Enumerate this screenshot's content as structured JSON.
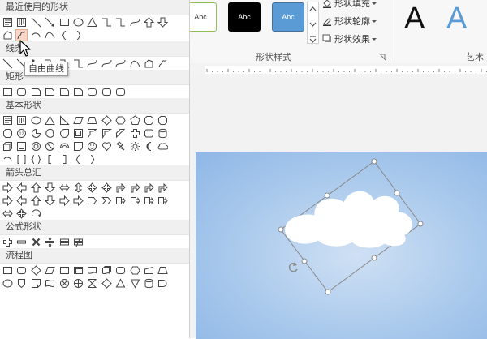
{
  "gallery": {
    "sections": [
      {
        "title": "最近使用的形状",
        "rows": [
          [
            "text-box",
            "vertical-text-box",
            "line",
            "arrow-line",
            "rectangle",
            "oval",
            "triangle",
            "elbow-connector",
            "elbow-arrow",
            "curved-arrow",
            "up-arrow",
            "down-arrow"
          ],
          [
            "freeform-shape",
            "freeform-scribble",
            "arc",
            "curve",
            "left-brace",
            "right-brace"
          ]
        ]
      },
      {
        "title": "线条",
        "rows": [
          [
            "line",
            "arrow-line",
            "double-arrow-line",
            "elbow-connector",
            "elbow-arrow",
            "elbow-double-arrow",
            "curved-connector",
            "curved-arrow",
            "curved-double-arrow",
            "curve",
            "freeform-shape",
            "freeform-scribble"
          ]
        ]
      },
      {
        "title": "矩形",
        "rows": [
          [
            "rectangle",
            "rounded-rectangle",
            "snip-corner-rectangle",
            "snip-same-side-rectangle",
            "snip-diagonal-rectangle",
            "snip-round-rectangle",
            "round-same-side-rectangle",
            "round-diagonal-rectangle",
            "round-corner-rectangle"
          ]
        ]
      },
      {
        "title": "基本形状",
        "rows": [
          [
            "text-box",
            "vertical-text-box",
            "oval",
            "triangle",
            "right-triangle",
            "parallelogram",
            "trapezoid",
            "diamond",
            "hexagon",
            "pentagon",
            "octagon",
            "decagon"
          ],
          [
            "dodecagon",
            "number-12",
            "pie",
            "chord",
            "teardrop",
            "frame",
            "half-frame",
            "l-shape",
            "diagonal-stripe",
            "cross",
            "plaque",
            "can"
          ],
          [
            "cube",
            "bevel",
            "donut",
            "no-symbol",
            "block-arc",
            "folded-corner",
            "smiley-face",
            "heart",
            "lightning-bolt",
            "sun",
            "moon",
            "cloud"
          ],
          [
            "arc",
            "double-bracket",
            "double-brace",
            "left-bracket",
            "right-bracket",
            "left-brace",
            "right-brace"
          ]
        ]
      },
      {
        "title": "箭头总汇",
        "rows": [
          [
            "right-arrow",
            "left-arrow",
            "up-arrow",
            "down-arrow",
            "left-right-arrow",
            "up-down-arrow",
            "quad-arrow",
            "left-right-up-arrow",
            "bent-arrow",
            "u-turn-arrow",
            "left-up-arrow",
            "bent-up-arrow"
          ],
          [
            "curved-right-arrow",
            "curved-left-arrow",
            "curved-up-arrow",
            "curved-down-arrow",
            "striped-right-arrow",
            "notched-right-arrow",
            "pentagon-arrow",
            "chevron",
            "right-arrow-callout",
            "down-arrow-callout",
            "left-arrow-callout",
            "up-arrow-callout"
          ],
          [
            "left-right-arrow-callout",
            "quad-arrow-callout",
            "circular-arrow"
          ]
        ]
      },
      {
        "title": "公式形状",
        "rows": [
          [
            "plus",
            "minus",
            "multiply",
            "divide",
            "equal",
            "not-equal"
          ]
        ]
      },
      {
        "title": "流程图",
        "rows": [
          [
            "flowchart-process",
            "flowchart-alternate-process",
            "flowchart-decision",
            "flowchart-data",
            "flowchart-predefined-process",
            "flowchart-internal-storage",
            "flowchart-document",
            "flowchart-multidocument",
            "flowchart-terminator",
            "flowchart-preparation",
            "flowchart-manual-input",
            "flowchart-manual-operation"
          ],
          [
            "flowchart-connector",
            "flowchart-offpage-connector",
            "flowchart-card",
            "flowchart-punched-tape",
            "flowchart-summing-junction",
            "flowchart-or",
            "flowchart-collate",
            "flowchart-sort",
            "flowchart-extract",
            "flowchart-merge",
            "flowchart-stored-data",
            "flowchart-delay"
          ]
        ]
      }
    ],
    "hover_index": [
      0,
      1,
      1
    ],
    "tooltip": "自由曲线",
    "cursor_icon": "pointer-arrow-icon"
  },
  "ribbon": {
    "style_swatches": [
      {
        "label": "Abc",
        "bg": "#ffffff",
        "fg": "#333333",
        "border": "#8cbf5a"
      },
      {
        "label": "Abc",
        "bg": "#000000",
        "fg": "#ffffff",
        "border": "#000000"
      },
      {
        "label": "Abc",
        "bg": "#5b9bd5",
        "fg": "#ffffff",
        "border": "#41719c"
      }
    ],
    "shape_fill_label": "形状填充",
    "shape_outline_label": "形状轮廓",
    "shape_effects_label": "形状效果",
    "shape_styles_group_label": "形状样式",
    "wordart_group_label": "艺术",
    "wordart_samples": [
      {
        "label": "A",
        "color": "#111111"
      },
      {
        "label": "A",
        "color": "#5b9bd5"
      }
    ],
    "dialog_launcher_icon": "dialog-launcher-icon",
    "gallery_scroll_icons": [
      "scroll-up-icon",
      "scroll-down-icon",
      "more-icon"
    ]
  },
  "canvas": {
    "slide_colors": [
      "#cfe0f4",
      "#8fb7e6"
    ],
    "selected_shape": "cloud",
    "rotate_handle_icon": "rotate-handle-icon"
  }
}
